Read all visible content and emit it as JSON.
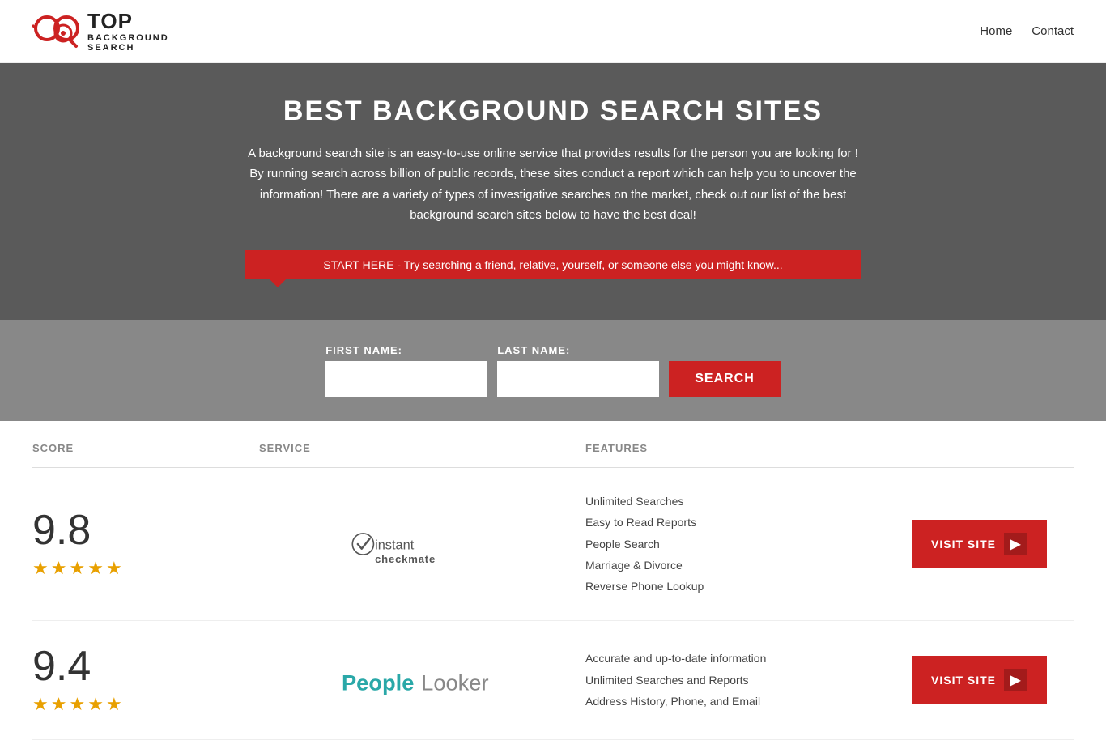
{
  "header": {
    "logo_top": "TOP",
    "logo_bottom": "BACKGROUND\nSEARCH",
    "nav": [
      {
        "label": "Home",
        "href": "#"
      },
      {
        "label": "Contact",
        "href": "#"
      }
    ]
  },
  "hero": {
    "title": "BEST BACKGROUND SEARCH SITES",
    "description": "A background search site is an easy-to-use online service that provides results  for the person you are looking for ! By  running  search across billion of public records, these sites conduct  a report which can help you to uncover the information! There are a variety of types of investigative searches on the market, check out our  list of the best background search sites below to have the best deal!",
    "search_banner": "START HERE - Try searching a friend, relative, yourself, or someone else you might know..."
  },
  "search_form": {
    "first_name_label": "FIRST NAME:",
    "last_name_label": "LAST NAME:",
    "button_label": "SEARCH",
    "first_name_placeholder": "",
    "last_name_placeholder": ""
  },
  "table": {
    "headers": {
      "score": "SCORE",
      "service": "SERVICE",
      "features": "FEATURES",
      "action": ""
    },
    "rows": [
      {
        "id": "instant-checkmate",
        "score": "9.8",
        "stars": 4.5,
        "logo_name": "Instant Checkmate",
        "features": [
          "Unlimited Searches",
          "Easy to Read Reports",
          "People Search",
          "Marriage & Divorce",
          "Reverse Phone Lookup"
        ],
        "button_label": "VISIT SITE"
      },
      {
        "id": "people-looker",
        "score": "9.4",
        "stars": 4.5,
        "logo_name": "PeopleLooker",
        "features": [
          "Accurate and up-to-date information",
          "Unlimited Searches and Reports",
          "Address History, Phone, and Email"
        ],
        "button_label": "VISIT SITE"
      }
    ]
  },
  "colors": {
    "primary_red": "#cc2222",
    "star_gold": "#e8a000",
    "dark_bg": "#5a5a5a",
    "medium_bg": "#888888"
  }
}
